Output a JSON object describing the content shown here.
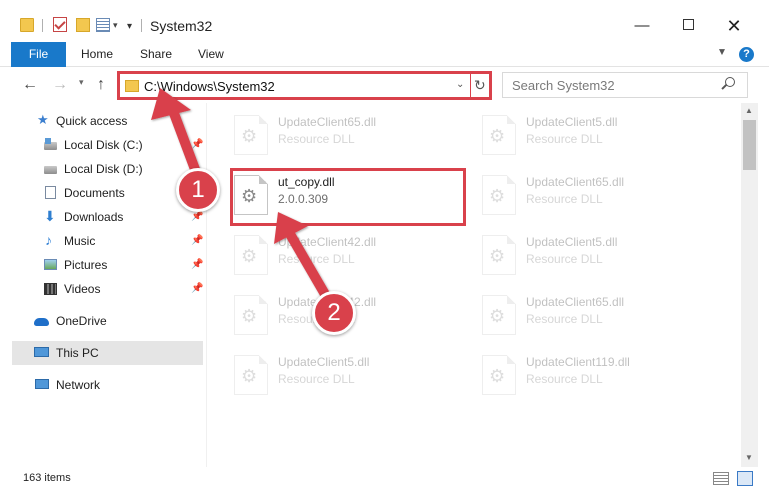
{
  "window": {
    "title": "System32",
    "minimize_glyph": "—",
    "close_glyph": "✕"
  },
  "ribbon": {
    "tabs": [
      "File",
      "Home",
      "Share",
      "View"
    ],
    "help_glyph": "?"
  },
  "navigation": {
    "address": "C:\\Windows\\System32",
    "search_placeholder": "Search System32"
  },
  "sidebar": {
    "items": [
      {
        "label": "Quick access",
        "icon": "star-icon",
        "pinned": false
      },
      {
        "label": "Local Disk (C:)",
        "icon": "disk-icon",
        "pinned": true
      },
      {
        "label": "Local Disk (D:)",
        "icon": "disk-icon",
        "pinned": false
      },
      {
        "label": "Documents",
        "icon": "documents-icon",
        "pinned": true
      },
      {
        "label": "Downloads",
        "icon": "download-icon",
        "pinned": true
      },
      {
        "label": "Music",
        "icon": "music-icon",
        "pinned": true
      },
      {
        "label": "Pictures",
        "icon": "pictures-icon",
        "pinned": true
      },
      {
        "label": "Videos",
        "icon": "videos-icon",
        "pinned": true
      },
      {
        "label": "OneDrive",
        "icon": "cloud-icon",
        "pinned": false
      },
      {
        "label": "This PC",
        "icon": "computer-icon",
        "pinned": false,
        "selected": true
      },
      {
        "label": "Network",
        "icon": "network-icon",
        "pinned": false
      }
    ]
  },
  "files": [
    {
      "name": "UpdateClient65.dll",
      "sub": "Resource DLL"
    },
    {
      "name": "UpdateClient5.dll",
      "sub": "Resource DLL"
    },
    {
      "name": "ut_copy.dll",
      "sub": "2.0.0.309"
    },
    {
      "name": "UpdateClient65.dll",
      "sub": "Resource DLL"
    },
    {
      "name": "UpdateClient42.dll",
      "sub": "Resource DLL"
    },
    {
      "name": "UpdateClient5.dll",
      "sub": "Resource DLL"
    },
    {
      "name": "UpdateClient42.dll",
      "sub": "Resource DLL"
    },
    {
      "name": "UpdateClient65.dll",
      "sub": "Resource DLL"
    },
    {
      "name": "UpdateClient5.dll",
      "sub": "Resource DLL"
    },
    {
      "name": "UpdateClient119.dll",
      "sub": "Resource DLL"
    }
  ],
  "status": {
    "item_count": "163 items"
  },
  "annotations": {
    "marker_1": "1",
    "marker_2": "2"
  },
  "colors": {
    "accent": "#1979ca",
    "annotation_red": "#d9414b"
  }
}
